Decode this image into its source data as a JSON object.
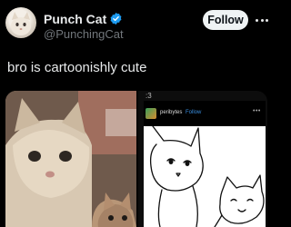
{
  "post": {
    "author_name": "Punch Cat",
    "author_handle": "@PunchingCat",
    "follow_label": "Follow",
    "text": "bro is cartoonishly cute"
  },
  "media": {
    "right_caption": ":3",
    "embedded_post": {
      "username": "peribytes",
      "follow_label": "Follow",
      "more_label": "•••"
    }
  },
  "colors": {
    "verified": "#1d9bf0",
    "follow_button_bg": "#eff3f4",
    "handle_text": "#71767b",
    "embedded_follow": "#3a8fe0"
  },
  "icons": {
    "verified": "verified-badge-icon",
    "more": "more-options-icon"
  }
}
